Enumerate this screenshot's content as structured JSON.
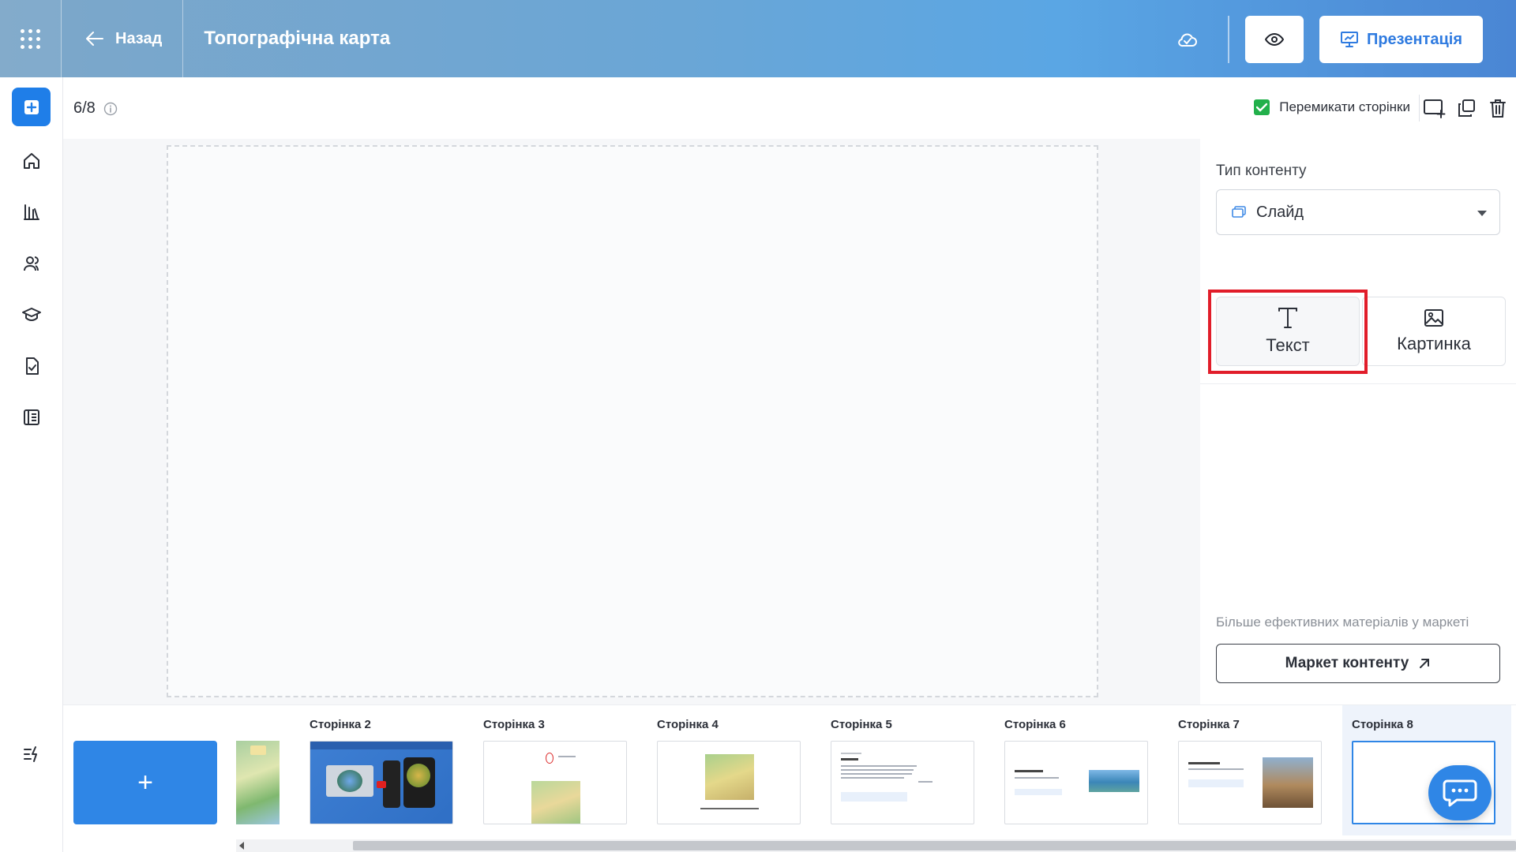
{
  "header": {
    "back_label": "Назад",
    "title": "Топографічна карта",
    "present_label": "Презентація"
  },
  "toolbar": {
    "page_counter": "6/8",
    "switch_pages_label": "Перемикати сторінки",
    "switch_pages_checked": true
  },
  "right_panel": {
    "content_type_label": "Тип контенту",
    "content_type_value": "Слайд",
    "types": [
      {
        "label": "Текст",
        "icon": "text-type-icon"
      },
      {
        "label": "Картинка",
        "icon": "image-icon"
      }
    ],
    "market_hint": "Більше ефективних матеріалів у маркеті",
    "market_button_label": "Маркет контенту"
  },
  "pages": [
    {
      "label": "Сторінка 2"
    },
    {
      "label": "Сторінка 3"
    },
    {
      "label": "Сторінка 4"
    },
    {
      "label": "Сторінка 5"
    },
    {
      "label": "Сторінка 6"
    },
    {
      "label": "Сторінка 7"
    },
    {
      "label": "Сторінка 8"
    }
  ],
  "add_page_label": "+",
  "colors": {
    "accent": "#2f86e6",
    "highlight": "#e11d2a",
    "checkbox": "#22b04b"
  }
}
